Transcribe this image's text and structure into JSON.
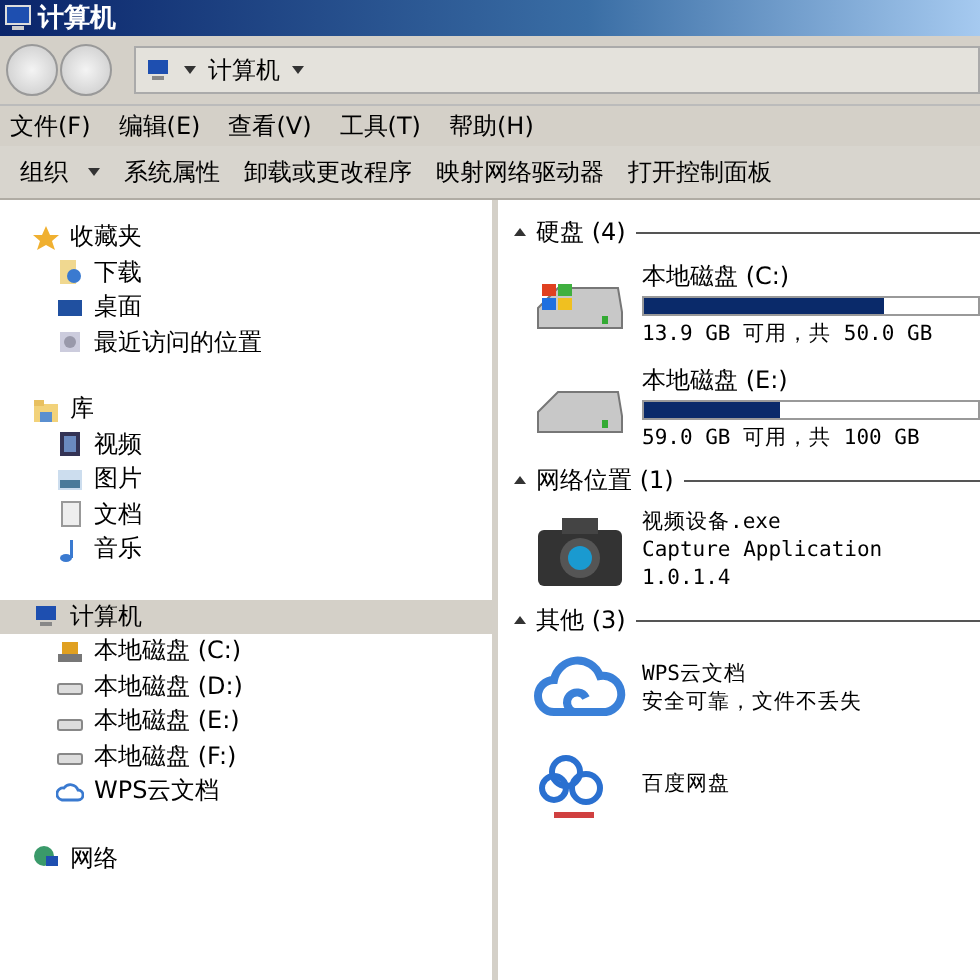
{
  "window": {
    "title": "计算机"
  },
  "address": {
    "path": "计算机"
  },
  "menu": [
    "文件(F)",
    "编辑(E)",
    "查看(V)",
    "工具(T)",
    "帮助(H)"
  ],
  "commands": [
    {
      "label": "组织",
      "dropdown": true
    },
    {
      "label": "系统属性",
      "dropdown": false
    },
    {
      "label": "卸载或更改程序",
      "dropdown": false
    },
    {
      "label": "映射网络驱动器",
      "dropdown": false
    },
    {
      "label": "打开控制面板",
      "dropdown": false
    }
  ],
  "sidebar": [
    {
      "label": "收藏夹",
      "selected": false,
      "children": [
        {
          "label": "下载"
        },
        {
          "label": "桌面"
        },
        {
          "label": "最近访问的位置"
        }
      ]
    },
    {
      "label": "库",
      "selected": false,
      "children": [
        {
          "label": "视频"
        },
        {
          "label": "图片"
        },
        {
          "label": "文档"
        },
        {
          "label": "音乐"
        }
      ]
    },
    {
      "label": "计算机",
      "selected": true,
      "children": [
        {
          "label": "本地磁盘 (C:)"
        },
        {
          "label": "本地磁盘 (D:)"
        },
        {
          "label": "本地磁盘 (E:)"
        },
        {
          "label": "本地磁盘 (F:)"
        },
        {
          "label": "WPS云文档"
        }
      ]
    },
    {
      "label": "网络",
      "selected": false
    }
  ],
  "groups": [
    {
      "title": "硬盘 (4)",
      "items": [
        {
          "kind": "drive",
          "name": "本地磁盘 (C:)",
          "level": 0.72,
          "reading": "13.9 GB 可用，共 50.0 GB"
        },
        {
          "kind": "drive",
          "name": "本地磁盘 (E:)",
          "level": 0.41,
          "reading": "59.0 GB 可用，共 100 GB"
        }
      ]
    },
    {
      "title": "网络位置 (1)",
      "items": [
        {
          "kind": "app",
          "lines": [
            "视频设备.exe",
            "Capture Application",
            "1.0.1.4"
          ]
        }
      ]
    },
    {
      "title": "其他 (3)",
      "items": [
        {
          "kind": "app",
          "lines": [
            "WPS云文档",
            "安全可靠，文件不丢失"
          ]
        },
        {
          "kind": "app",
          "lines": [
            "百度网盘"
          ]
        }
      ]
    }
  ]
}
